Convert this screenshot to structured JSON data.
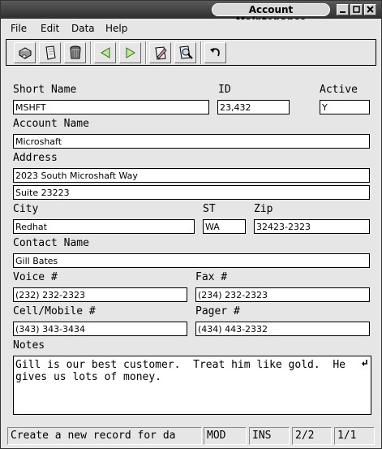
{
  "window": {
    "title": "Account Maintenance"
  },
  "menu": {
    "file": "File",
    "edit": "Edit",
    "data": "Data",
    "help": "Help"
  },
  "toolbar": {
    "icons": [
      "new-record-icon",
      "open-record-icon",
      "delete-record-icon",
      "previous-record-icon",
      "next-record-icon",
      "edit-record-icon",
      "search-icon",
      "undo-icon"
    ]
  },
  "form": {
    "short_name": {
      "label": "Short Name",
      "value": "MSHFT"
    },
    "id": {
      "label": "ID",
      "value": "23,432"
    },
    "active": {
      "label": "Active",
      "value": "Y"
    },
    "account_name": {
      "label": "Account Name",
      "value": "Microshaft"
    },
    "address": {
      "label": "Address",
      "line1": "2023 South Microshaft Way",
      "line2": "Suite 23223"
    },
    "city": {
      "label": "City",
      "value": "Redhat"
    },
    "state": {
      "label": "ST",
      "value": "WA"
    },
    "zip": {
      "label": "Zip",
      "value": "32423-2323"
    },
    "contact_name": {
      "label": "Contact Name",
      "value": "Gill Bates"
    },
    "voice": {
      "label": "Voice #",
      "value": "(232) 232-2323"
    },
    "fax": {
      "label": "Fax #",
      "value": "(234) 232-2323"
    },
    "cell": {
      "label": "Cell/Mobile #",
      "value": "(343) 343-3434"
    },
    "pager": {
      "label": "Pager #",
      "value": "(434) 443-2332"
    },
    "notes": {
      "label": "Notes",
      "value": "Gill is our best customer.  Treat him like gold.  He gives us lots of money."
    }
  },
  "status": {
    "message": "Create a new record for da",
    "mode": "MOD",
    "insert": "INS",
    "record": "2/2",
    "page": "1/1"
  }
}
